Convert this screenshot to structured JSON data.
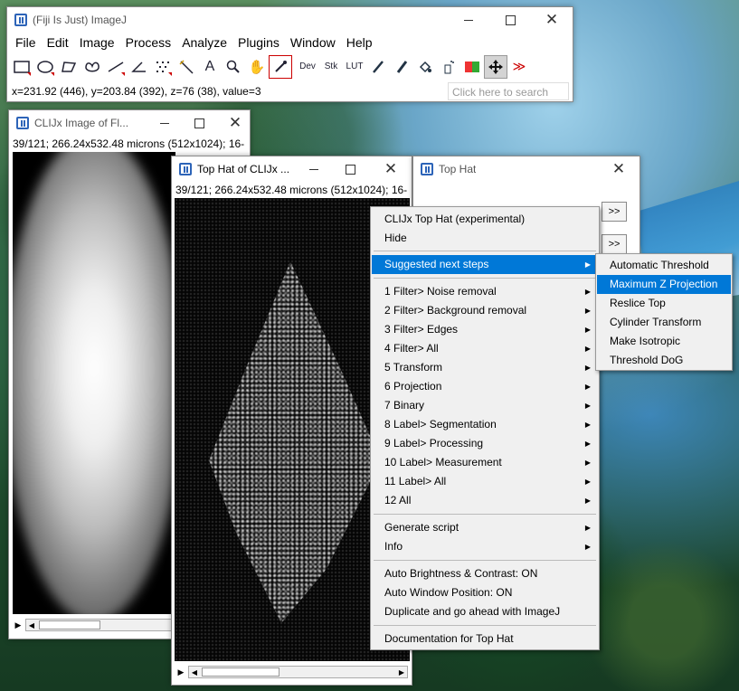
{
  "main_window": {
    "title": "(Fiji Is Just) ImageJ",
    "menus": [
      "File",
      "Edit",
      "Image",
      "Process",
      "Analyze",
      "Plugins",
      "Window",
      "Help"
    ],
    "tool_labels": {
      "dev": "Dev",
      "stk": "Stk",
      "lut": "LUT",
      "more": "≫"
    },
    "status": "x=231.92 (446), y=203.84 (392), z=76 (38), value=3",
    "search_placeholder": "Click here to search"
  },
  "image_window_1": {
    "title": "CLIJx Image of Fl...",
    "info": "39/121; 266.24x532.48 microns (512x1024); 16-"
  },
  "image_window_2": {
    "title": "Top Hat of CLIJx ...",
    "info": "39/121; 266.24x532.48 microns (512x1024); 16-"
  },
  "dialog": {
    "title": "Top Hat",
    "btn_label": ">>"
  },
  "context_menu": {
    "items": [
      {
        "label": "CLIJx Top Hat (experimental)",
        "sub": false
      },
      {
        "label": "Hide",
        "sub": false
      },
      {
        "label": "Suggested next steps",
        "sub": true
      },
      {
        "label": "1 Filter> Noise removal",
        "sub": true
      },
      {
        "label": "2 Filter> Background removal",
        "sub": true
      },
      {
        "label": "3 Filter> Edges",
        "sub": true
      },
      {
        "label": "4 Filter> All",
        "sub": true
      },
      {
        "label": "5 Transform",
        "sub": true
      },
      {
        "label": "6 Projection",
        "sub": true
      },
      {
        "label": "7 Binary",
        "sub": true
      },
      {
        "label": "8 Label> Segmentation",
        "sub": true
      },
      {
        "label": "9 Label> Processing",
        "sub": true
      },
      {
        "label": "10 Label> Measurement",
        "sub": true
      },
      {
        "label": "11 Label> All",
        "sub": true
      },
      {
        "label": "12 All",
        "sub": true
      },
      {
        "label": "Generate script",
        "sub": true
      },
      {
        "label": "Info",
        "sub": true
      },
      {
        "label": "Auto Brightness & Contrast: ON",
        "sub": false
      },
      {
        "label": "Auto Window Position: ON",
        "sub": false
      },
      {
        "label": "Duplicate and go ahead with ImageJ",
        "sub": false
      },
      {
        "label": "Documentation for Top Hat",
        "sub": false
      }
    ]
  },
  "submenu": {
    "items": [
      "Automatic Threshold",
      "Maximum Z Projection",
      "Reslice Top",
      "Cylinder Transform",
      "Make Isotropic",
      "Threshold DoG"
    ]
  },
  "icons": [
    "rectangle-tool-icon",
    "oval-tool-icon",
    "polygon-tool-icon",
    "freehand-tool-icon",
    "line-tool-icon",
    "angle-tool-icon",
    "point-tool-icon",
    "wand-tool-icon",
    "text-tool-icon",
    "magnifier-icon",
    "hand-icon",
    "color-picker-icon",
    "pencil-icon",
    "brush-icon",
    "flood-fill-icon",
    "spray-icon",
    "color-icon",
    "move-icon"
  ]
}
